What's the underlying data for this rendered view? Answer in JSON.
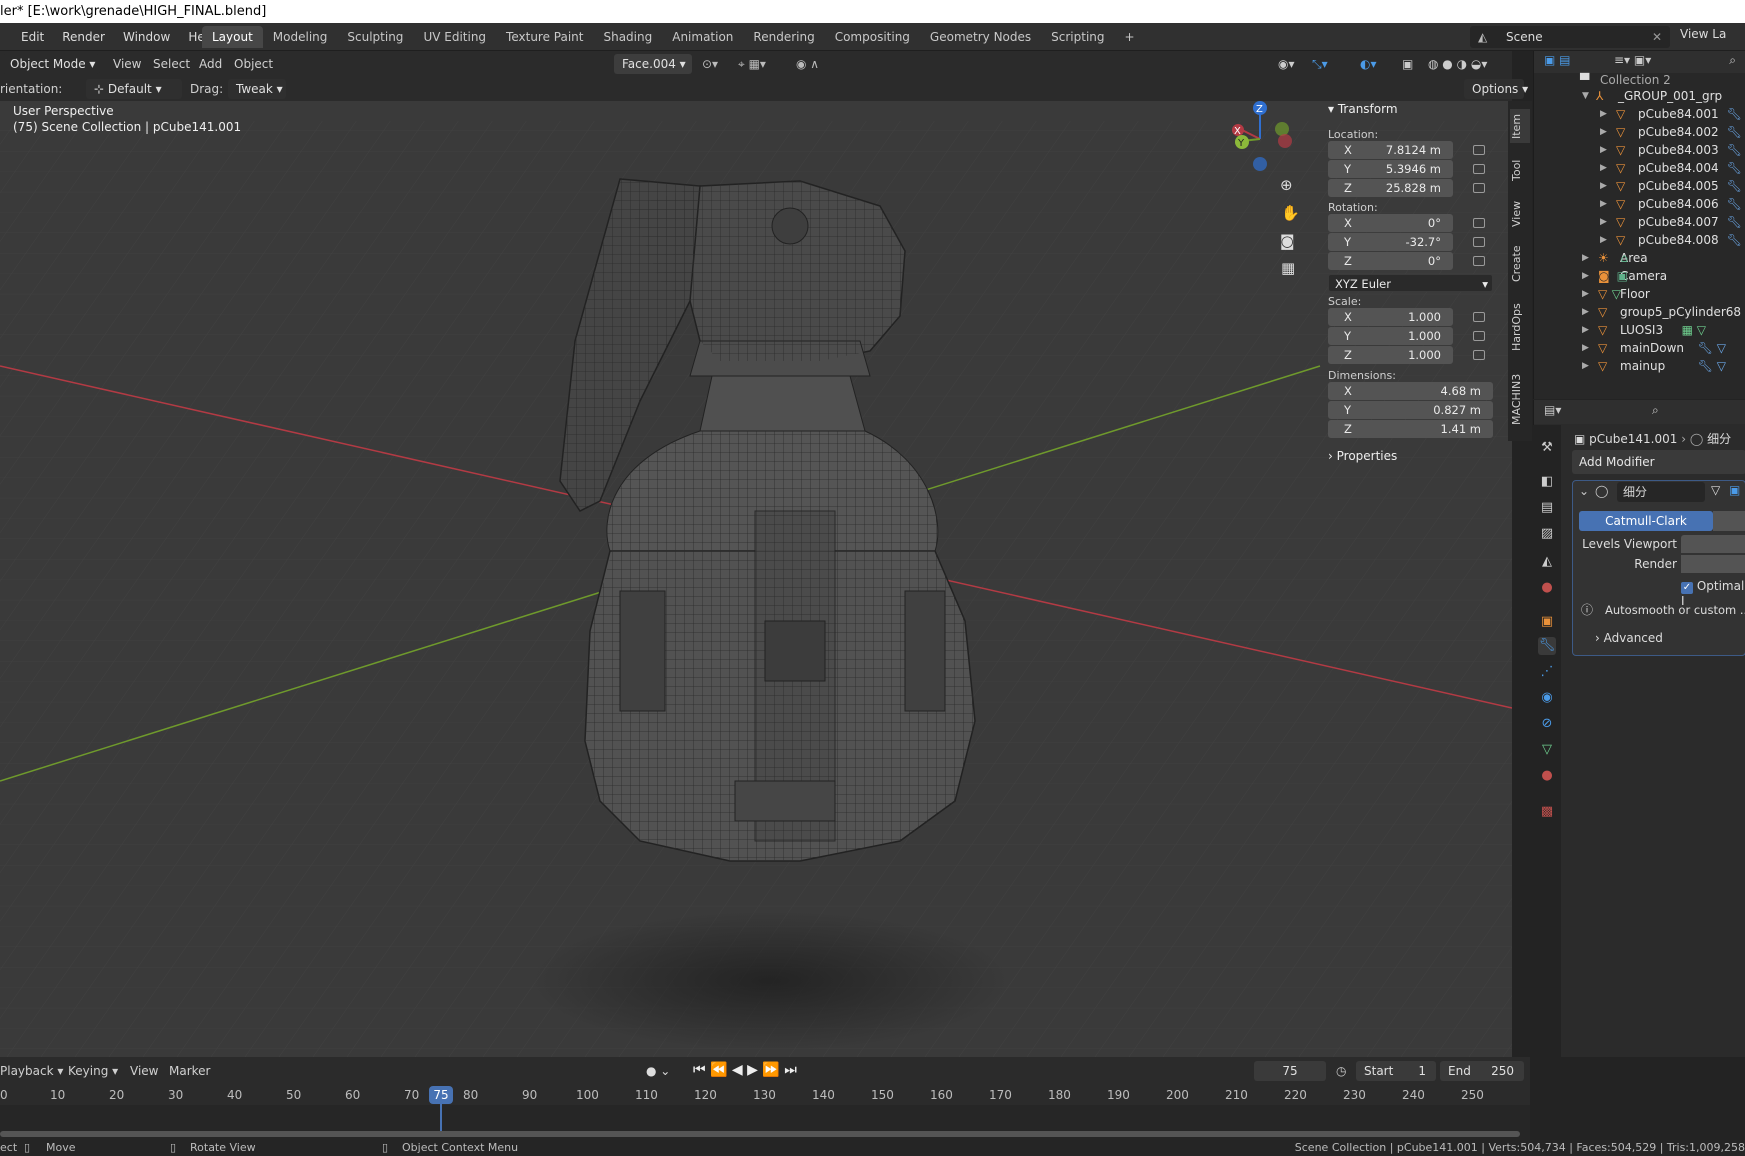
{
  "window": {
    "title": "ler* [E:\\work\\grenade\\HIGH_FINAL.blend]"
  },
  "menu": [
    "Edit",
    "Render",
    "Window",
    "Help"
  ],
  "workspaces": [
    "Layout",
    "Modeling",
    "Sculpting",
    "UV Editing",
    "Texture Paint",
    "Shading",
    "Animation",
    "Rendering",
    "Compositing",
    "Geometry Nodes",
    "Scripting",
    "+"
  ],
  "active_workspace": "Layout",
  "scene": {
    "name": "Scene",
    "view_layer": "View La"
  },
  "header": {
    "mode": "Object Mode",
    "view": "View",
    "select": "Select",
    "add": "Add",
    "object": "Object",
    "face_set": "Face.004",
    "orientation_label": "rientation:",
    "orientation_value": "Default",
    "drag_label": "Drag:",
    "drag_value": "Tweak",
    "options": "Options"
  },
  "viewport": {
    "perspective": "User Perspective",
    "info": "(75) Scene Collection | pCube141.001",
    "colors": {
      "x_axis": "#b33a44",
      "y_axis": "#6f9a2c",
      "bg": "#3a3a3a"
    }
  },
  "npanel": {
    "title": "Transform",
    "location_label": "Location:",
    "location": [
      {
        "axis": "X",
        "value": "7.8124 m"
      },
      {
        "axis": "Y",
        "value": "5.3946 m"
      },
      {
        "axis": "Z",
        "value": "25.828 m"
      }
    ],
    "rotation_label": "Rotation:",
    "rotation": [
      {
        "axis": "X",
        "value": "0°"
      },
      {
        "axis": "Y",
        "value": "-32.7°"
      },
      {
        "axis": "Z",
        "value": "0°"
      }
    ],
    "rotation_mode": "XYZ Euler",
    "scale_label": "Scale:",
    "scale": [
      {
        "axis": "X",
        "value": "1.000"
      },
      {
        "axis": "Y",
        "value": "1.000"
      },
      {
        "axis": "Z",
        "value": "1.000"
      }
    ],
    "dimensions_label": "Dimensions:",
    "dimensions": [
      {
        "axis": "X",
        "value": "4.68 m"
      },
      {
        "axis": "Y",
        "value": "0.827 m"
      },
      {
        "axis": "Z",
        "value": "1.41 m"
      }
    ],
    "properties": "Properties",
    "tabs": [
      "Item",
      "Tool",
      "View",
      "Create",
      "HardOps",
      "MACHIN3"
    ]
  },
  "outliner": {
    "collection": "Collection 2",
    "group": "_GROUP_001_grp",
    "items": [
      "pCube84.001",
      "pCube84.002",
      "pCube84.003",
      "pCube84.004",
      "pCube84.005",
      "pCube84.006",
      "pCube84.007",
      "pCube84.008"
    ],
    "objects": [
      "Area",
      "Camera",
      "Floor",
      "group5_pCylinder68",
      "LUOSI3",
      "mainDown",
      "mainup"
    ]
  },
  "properties": {
    "object": "pCube141.001",
    "breadcrumb_extra": "细分",
    "add_modifier": "Add Modifier",
    "modifier_name": "细分",
    "catmull": "Catmull-Clark",
    "levels_viewport": "Levels Viewport",
    "render": "Render",
    "optimal": "Optimal I",
    "autosmooth": "Autosmooth or custom ...isab",
    "advanced": "Advanced"
  },
  "timeline": {
    "playback": "Playback",
    "keying": "Keying",
    "view": "View",
    "marker": "Marker",
    "current_frame": "75",
    "start_label": "Start",
    "start": "1",
    "end_label": "End",
    "end": "250",
    "ticks": [
      "0",
      "10",
      "20",
      "30",
      "40",
      "50",
      "60",
      "70",
      "80",
      "90",
      "100",
      "110",
      "120",
      "130",
      "140",
      "150",
      "160",
      "170",
      "180",
      "190",
      "200",
      "210",
      "220",
      "230",
      "240",
      "250"
    ]
  },
  "status": {
    "left1": "ect",
    "move": "Move",
    "rotate": "Rotate View",
    "context": "Object Context Menu",
    "right": "Scene Collection | pCube141.001 | Verts:504,734 | Faces:504,529 | Tris:1,009,258"
  }
}
